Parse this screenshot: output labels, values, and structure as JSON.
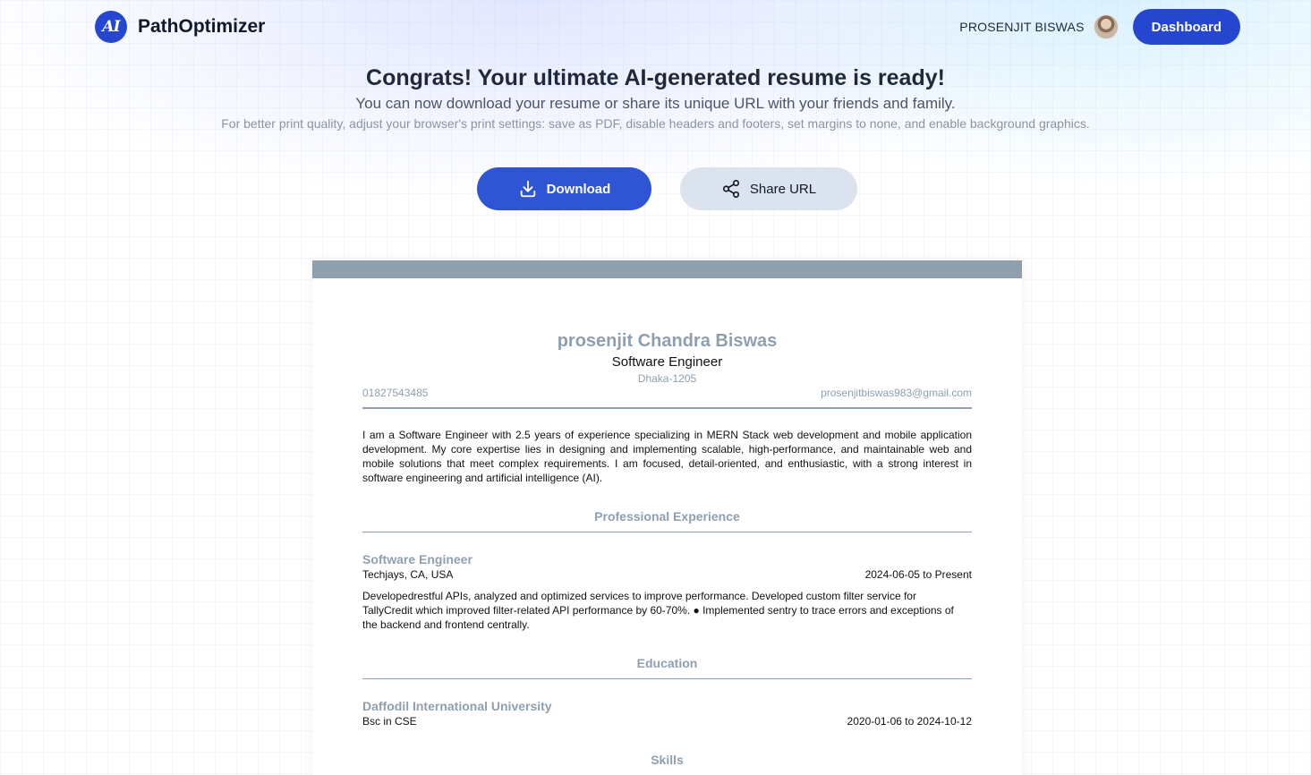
{
  "brand": {
    "logo_text": "AI",
    "name": "PathOptimizer"
  },
  "user": {
    "name": "PROSENJIT BISWAS",
    "dashboard_label": "Dashboard"
  },
  "hero": {
    "title": "Congrats! Your ultimate AI-generated resume is ready!",
    "subtitle": "You can now download your resume or share its unique URL with your friends and family.",
    "note": "For better print quality, adjust your browser's print settings: save as PDF, disable headers and footers, set margins to none, and enable background graphics."
  },
  "actions": {
    "download_label": "Download",
    "download_icon": "download-icon",
    "share_label": "Share URL",
    "share_icon": "share-icon"
  },
  "resume": {
    "name": "prosenjit Chandra Biswas",
    "title": "Software Engineer",
    "location": "Dhaka-1205",
    "phone": "01827543485",
    "email": "prosenjitbiswas983@gmail.com",
    "summary": "I am a Software Engineer with 2.5 years of experience specializing in MERN Stack web development and mobile application development. My core expertise lies in designing and implementing scalable, high-performance, and maintainable web and mobile solutions that meet complex requirements. I am focused, detail-oriented, and enthusiastic, with a strong interest in software engineering and artificial intelligence (AI).",
    "experience_heading": "Professional Experience",
    "experience": [
      {
        "role": "Software Engineer",
        "company": "Techjays, CA, USA",
        "dates": "2024-06-05 to Present",
        "description": "Developedrestful APIs, analyzed and optimized services to improve performance. Developed custom filter service for TallyCredit which improved filter-related API performance by 60-70%. ● Implemented sentry to trace errors and exceptions of the backend and frontend centrally."
      }
    ],
    "education_heading": "Education",
    "education": [
      {
        "school": "Daffodil International University",
        "degree": "Bsc in CSE",
        "dates": "2020-01-06 to 2024-10-12"
      }
    ],
    "skills_heading": "Skills"
  },
  "colors": {
    "primary": "#2547d0",
    "resume_accent": "#8f9fad",
    "share_bg": "#dbe3ee"
  }
}
